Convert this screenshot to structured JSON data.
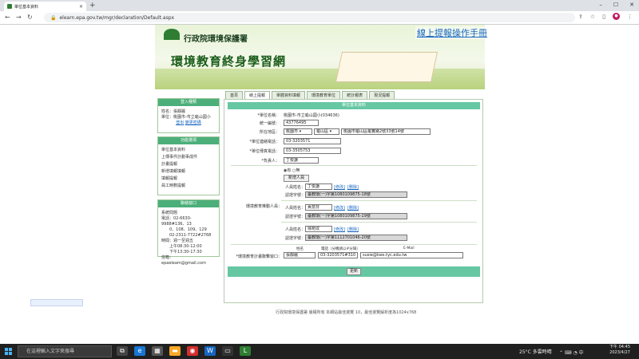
{
  "browser": {
    "tab_title": "單位基本資料",
    "url": "elearn.epa.gov.tw/mgr/declaration/Default.aspx"
  },
  "header": {
    "agency": "行政院環境保護署",
    "site_title": "環境教育終身學習網",
    "manual_link": "線上提報操作手冊"
  },
  "menu": [
    "首頁",
    "線上提報",
    "單體資料填報",
    "環境教育單位",
    "統計報表",
    "現況提報"
  ],
  "sidebar": {
    "info_title": "登入種類",
    "name_line": "姓名：張靜麗",
    "unit_line": "單位：桃園市-市立龜山國小",
    "logout": "登出",
    "change_pw": "變更密碼",
    "func_title": "功能選項",
    "func_items": [
      "單位基本資料",
      "上傳事件計劃事成件",
      "計畫提報",
      "新增填報填報",
      "填報提報",
      "員工時數提報"
    ],
    "contact_title": "聯絡窗口",
    "contact_lines": [
      "系統問題",
      "電話：02-6630-9988#136、13",
      "0、108、109、129",
      "02-2311-7722#2768",
      "時間：週一至週五",
      "上午08:30-12:00",
      "下午13:30-17:30",
      "信箱：epaeleam@gmail.com"
    ]
  },
  "form": {
    "title": "單位基本資料",
    "unit_name_label": "*單位名稱：",
    "unit_name": "桃園市-市立龜山國小(034636)",
    "tax_id_label": "統一編號：",
    "tax_id": "43776495",
    "address_label": "所在地區：",
    "city": "桃園市 ▾",
    "district": "龜山區 ▾",
    "address": "桃園市龜山區龜實路2號33號14號",
    "phone_label": "*單位連絡電話：",
    "phone": "03-3203571",
    "fax_label": "*單位傳真電話：",
    "fax": "03-3505753",
    "head_label": "*負責人：",
    "head": "丁俊謙",
    "radio_yes": "有",
    "radio_no": "無",
    "add_person_btn": "新增人員",
    "personnel_section_label": "環境教育推動人員：",
    "person_label": "人員姓名：",
    "cert_label": "認證字號：",
    "edit": "[修改]",
    "delete": "[刪除]",
    "persons": [
      {
        "name": "丁俊謙",
        "cert": "臺教環(一)字第1080109875-18號"
      },
      {
        "name": "黃慧芬",
        "cert": "臺教環(一)字第1080109875-19號"
      },
      {
        "name": "徐宛玟",
        "cert": "臺教環(一)字第1112701046-20號"
      }
    ],
    "contact_label": "*環境教育計畫聯繫窗口：",
    "col_name": "姓名",
    "col_phone": "電話（分機請以#分隔）",
    "col_email": "E-Mail",
    "contact_name": "張靜麗",
    "contact_phone": "03-3203571#310",
    "contact_email": "susie@lses.tyc.edu.tw",
    "submit_btn": "更新"
  },
  "footer": "行政院環境保護署 版權所有 本網站最佳瀏覽 10，最佳瀏覽解析度為1024x768",
  "taskbar": {
    "search_placeholder": "在這裡輸入文字來搜尋",
    "weather": "25°C 多雲時晴",
    "time": "下午 04:45",
    "date": "2023/4/27"
  },
  "colors": {
    "accent_green": "#66c7a3",
    "link_blue": "#1565c0"
  }
}
